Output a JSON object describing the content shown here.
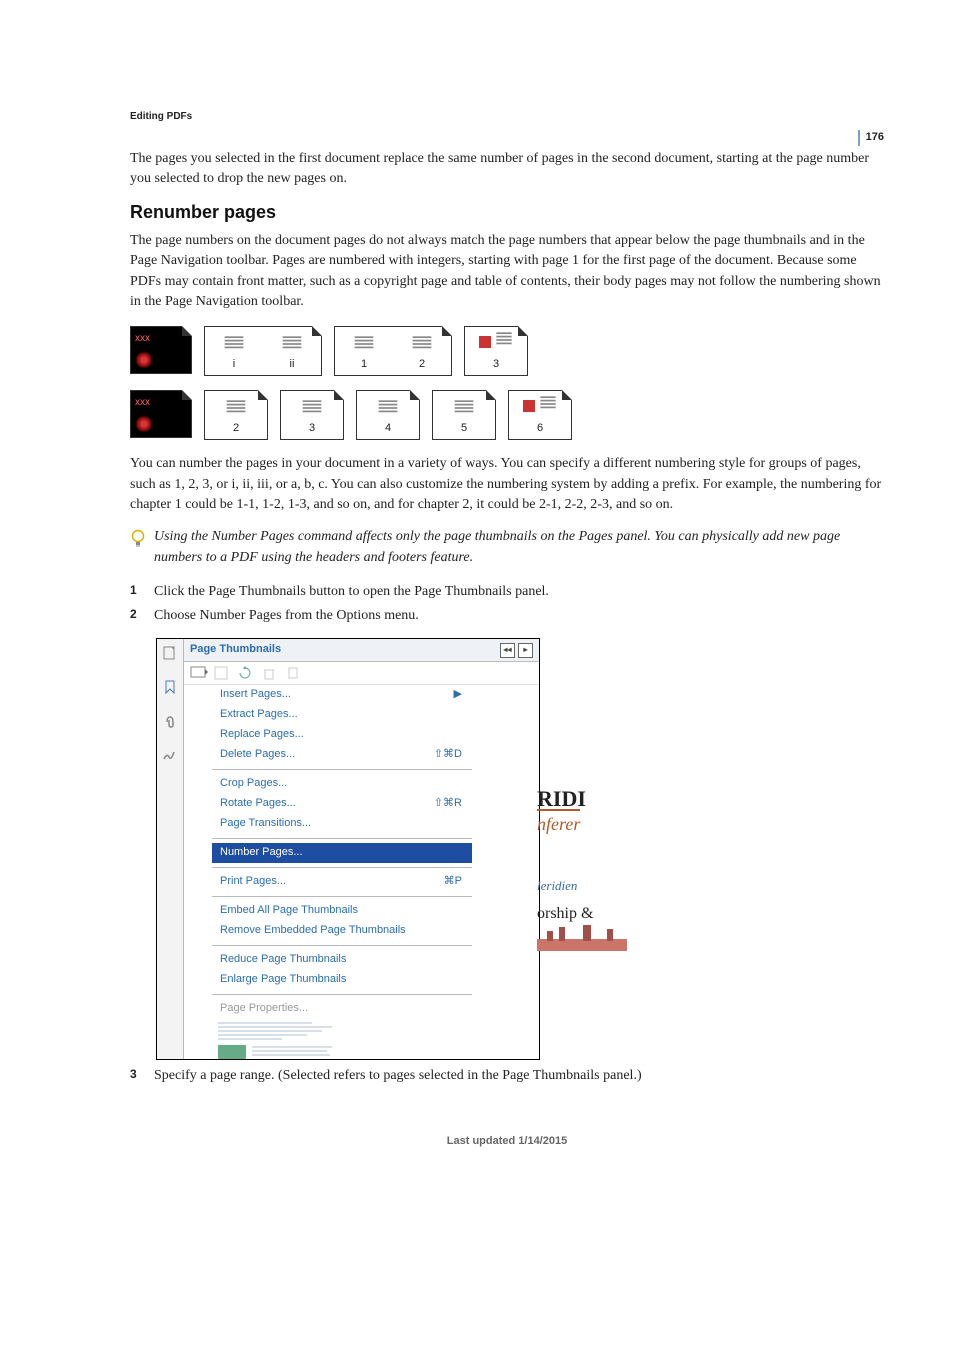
{
  "page_number": "176",
  "section_label": "Editing PDFs",
  "intro_continuation": "The pages you selected in the first document replace the same number of pages in the second document, starting at the page number you selected to drop the new pages on.",
  "heading": "Renumber pages",
  "para1": "The page numbers on the document pages do not always match the page numbers that appear below the page thumbnails and in the Page Navigation toolbar. Pages are numbered with integers, starting with page 1 for the first page of the document. Because some PDFs may contain front matter, such as a copyright page and table of contents, their body pages may not follow the numbering shown in the Page Navigation toolbar.",
  "para2": "You can number the pages in your document in a variety of ways. You can specify a different numbering style for groups of pages, such as 1, 2, 3, or i, ii, iii, or a, b, c. You can also customize the numbering system by adding a prefix. For example, the numbering for chapter 1 could be 1-1, 1-2, 1-3, and so on, and for chapter 2, it could be 2-1, 2-2, 2-3, and so on.",
  "note": "Using the Number Pages command affects only the page thumbnails on the Pages panel. You can physically add new page numbers to a PDF using the headers and footers feature.",
  "steps": [
    "Click the Page Thumbnails button to open the Page Thumbnails panel.",
    "Choose Number Pages from the Options menu.",
    "Specify a page range. (Selected refers to pages selected in the Page Thumbnails panel.)"
  ],
  "fig_labels": {
    "cover": "xxx",
    "i": "i",
    "ii": "ii",
    "n1": "1",
    "n2": "2",
    "n3": "3",
    "n4": "4",
    "n5": "5",
    "n6": "6"
  },
  "panel": {
    "title": "Page Thumbnails",
    "menu": {
      "insert": "Insert Pages...",
      "extract": "Extract Pages...",
      "replace": "Replace Pages...",
      "delete": "Delete Pages...",
      "delete_sc": "⇧⌘D",
      "crop": "Crop Pages...",
      "rotate": "Rotate Pages...",
      "rotate_sc": "⇧⌘R",
      "transitions": "Page Transitions...",
      "number": "Number Pages...",
      "print": "Print Pages...",
      "print_sc": "⌘P",
      "embed": "Embed All Page Thumbnails",
      "remove_embed": "Remove Embedded Page Thumbnails",
      "reduce": "Reduce Page Thumbnails",
      "enlarge": "Enlarge Page Thumbnails",
      "props": "Page Properties..."
    },
    "side_art": {
      "ridi": "RIDI",
      "nferer": "nferer",
      "leridien": "leridien",
      "orship": "orship &"
    }
  },
  "footer": "Last updated 1/14/2015"
}
